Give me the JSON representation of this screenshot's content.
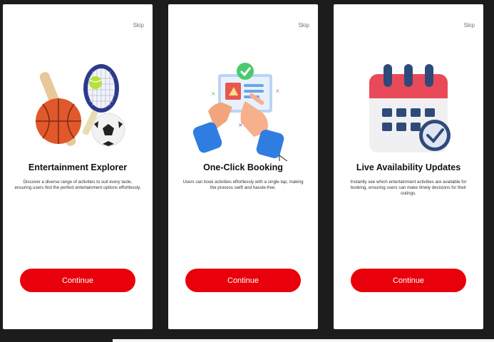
{
  "colors": {
    "accent": "#e8000b",
    "background": "#1c1c1c",
    "card": "#ffffff"
  },
  "screens": [
    {
      "skip": "Skip",
      "illustration": "sports-equipment-icon",
      "title": "Entertainment Explorer",
      "description": "Discover a diverse range of activities to suit every taste, ensuring users find the perfect entertainment options effortlessly.",
      "button": "Continue"
    },
    {
      "skip": "Skip",
      "illustration": "tap-booking-icon",
      "title": "One-Click Booking",
      "description": "Users can book activities effortlessly with a single tap, making the process swift and hassle-free.",
      "button": "Continue"
    },
    {
      "skip": "Skip",
      "illustration": "calendar-check-icon",
      "title": "Live Availability Updates",
      "description": "Instantly see which entertainment activities are available for booking, ensuring users can make timely decisions for their outings.",
      "button": "Continue"
    }
  ]
}
